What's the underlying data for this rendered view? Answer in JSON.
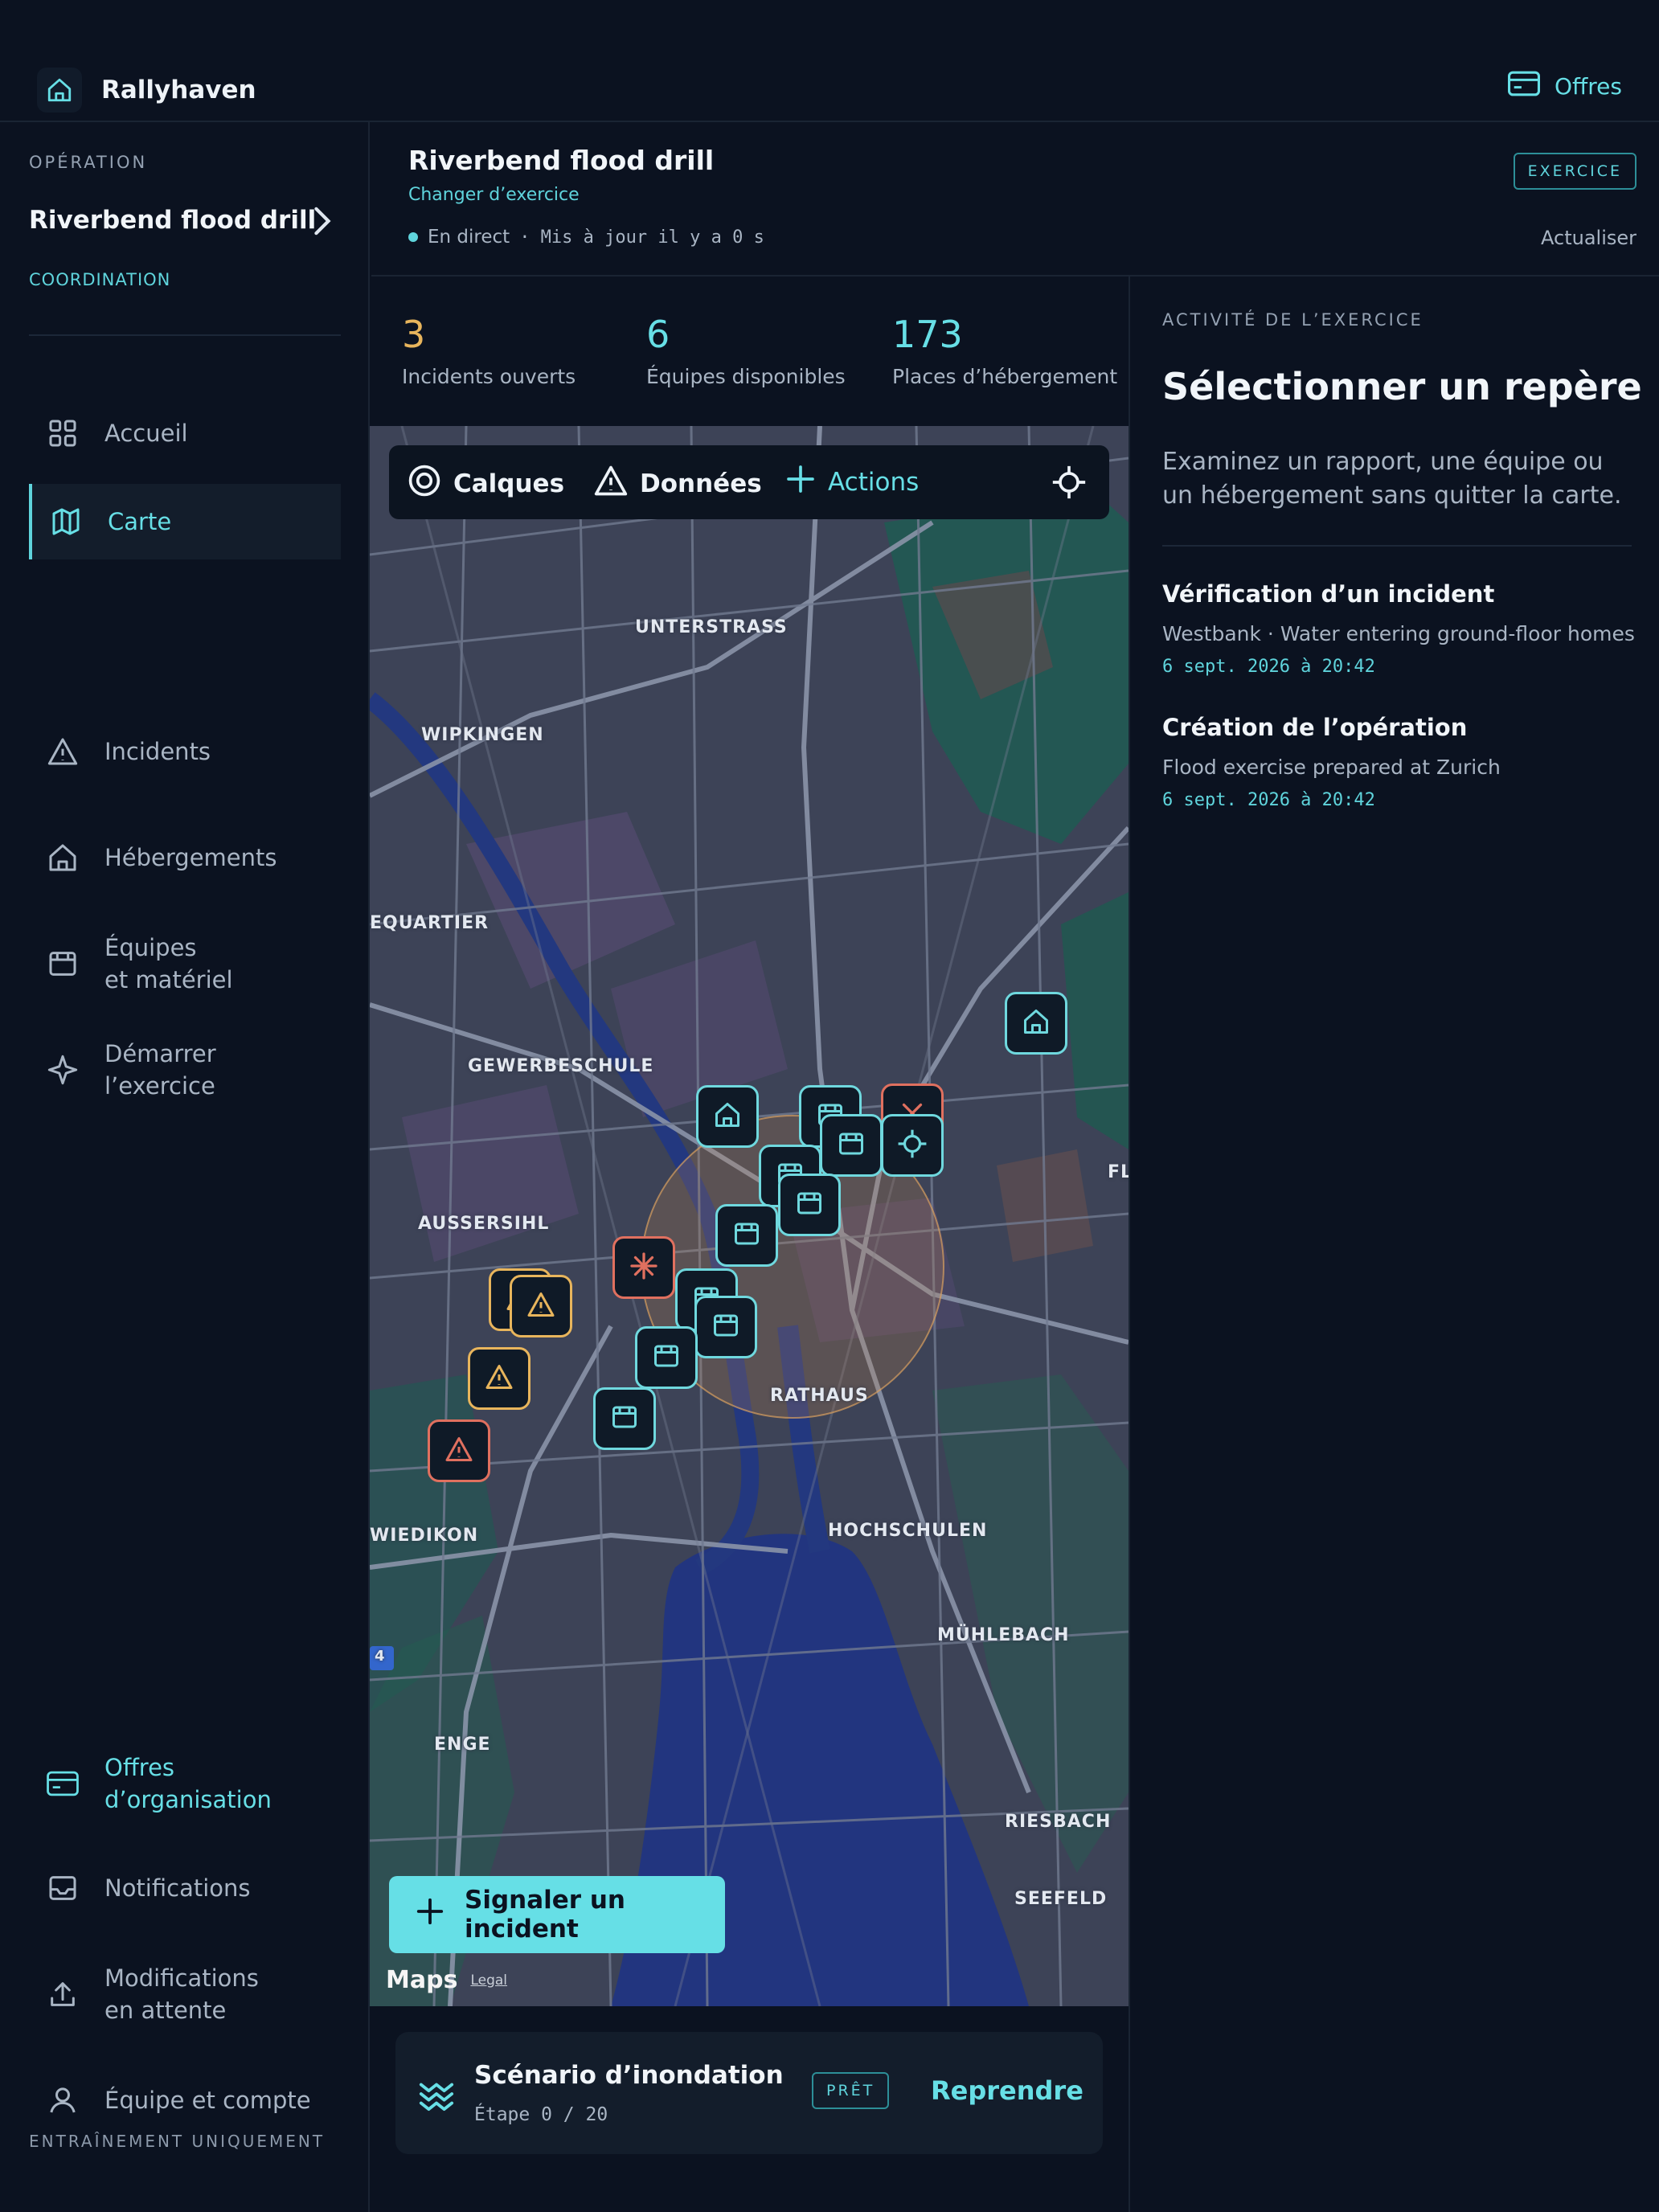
{
  "app": {
    "name": "Rallyhaven",
    "offers_label": "Offres"
  },
  "sidebar": {
    "operation_label": "OPÉRATION",
    "operation_name": "Riverbend flood drill",
    "role": "COORDINATION",
    "items": [
      {
        "label": "Accueil",
        "icon": "grid-icon"
      },
      {
        "label": "Carte",
        "icon": "map-icon",
        "active": true
      },
      {
        "label": "Incidents",
        "icon": "warning-icon"
      },
      {
        "label": "Hébergements",
        "icon": "home-icon"
      },
      {
        "label_1": "Équipes",
        "label_2": "et matériel",
        "icon": "equipment-icon"
      },
      {
        "label_1": "Démarrer",
        "label_2": "l’exercice",
        "icon": "sparkle-icon"
      }
    ],
    "bottom_items": [
      {
        "label_1": "Offres",
        "label_2": "d’organisation",
        "icon": "card-icon"
      },
      {
        "label": "Notifications",
        "icon": "inbox-icon"
      },
      {
        "label_1": "Modifications",
        "label_2": "en attente",
        "icon": "upload-icon"
      },
      {
        "label": "Équipe et compte",
        "icon": "user-icon"
      }
    ],
    "footer": "ENTRAÎNEMENT UNIQUEMENT"
  },
  "header": {
    "title": "Riverbend flood drill",
    "change_label": "Changer d’exercice",
    "live_label": "En direct",
    "updated": "· Mis à jour il y a 0 s",
    "badge": "EXERCICE",
    "refresh": "Actualiser"
  },
  "stats": [
    {
      "value": "3",
      "label": "Incidents ouverts",
      "color": "#e8b55c"
    },
    {
      "value": "6",
      "label": "Équipes disponibles",
      "color": "#67dfe6"
    },
    {
      "value": "173",
      "label": "Places d’hébergement",
      "color": "#67dfe6"
    }
  ],
  "map": {
    "toolbar": {
      "layers": "Calques",
      "data": "Données",
      "actions": "Actions"
    },
    "districts": {
      "unterstrass": "UNTERSTRASS",
      "wipkingen": "WIPKINGEN",
      "equartier": "EQUARTIER",
      "gewerbeschule": "GEWERBESCHULE",
      "aussersihl": "AUSSERSIHL",
      "rathaus": "RATHAUS",
      "wiedikon": "WIEDIKON",
      "hochschulen": "HOCHSCHULEN",
      "muhlebach": "MÜHLEBACH",
      "enge": "ENGE",
      "riesbach": "RIESBACH",
      "seefeld": "SEEFELD",
      "fl": "FL"
    },
    "report_button": "Signaler un incident",
    "attribution": "Maps",
    "legal": "Legal",
    "route_shield": "4"
  },
  "scenario": {
    "title": "Scénario d’inondation",
    "step": "Étape 0 / 20",
    "badge": "PRÊT",
    "resume": "Reprendre"
  },
  "panel": {
    "label": "ACTIVITÉ DE L’EXERCICE",
    "title": "Sélectionner un repère",
    "description": "Examinez un rapport, une équipe ou un hébergement sans quitter la carte.",
    "activities": [
      {
        "title": "Vérification d’un incident",
        "detail": "Westbank · Water entering ground-floor homes",
        "timestamp": "6 sept. 2026 à 20:42"
      },
      {
        "title": "Création de l’opération",
        "detail": "Flood exercise prepared at Zurich",
        "timestamp": "6 sept. 2026 à 20:42"
      }
    ]
  }
}
